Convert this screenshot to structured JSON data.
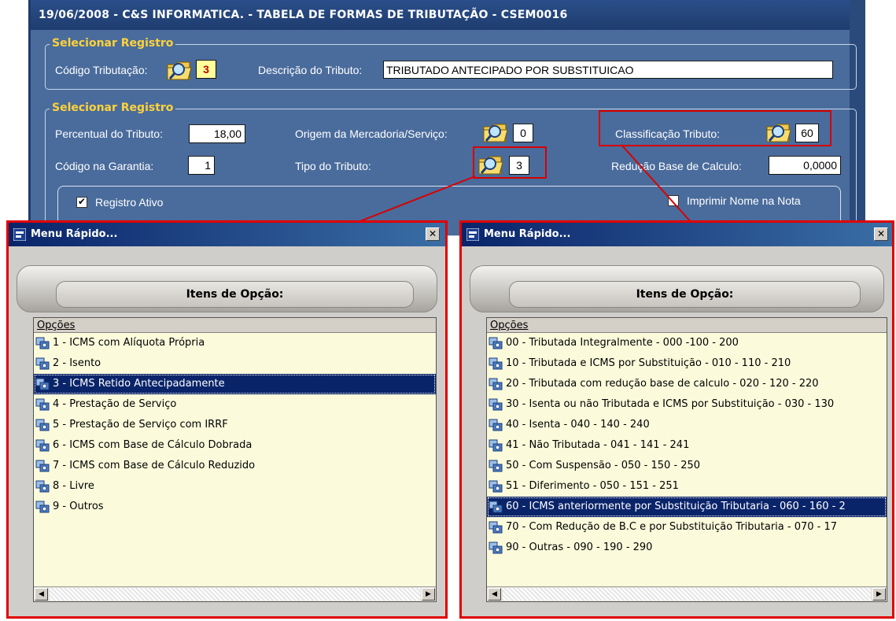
{
  "main": {
    "title": "19/06/2008  -  C&S INFORMATICA.  -  TABELA DE FORMAS DE TRIBUTAÇÃO  -  CSEM0016",
    "group1_title": "Selecionar Registro",
    "group2_title": "Selecionar Registro",
    "codigo_tributacao_label": "Código Tributação:",
    "codigo_tributacao_value": "3",
    "descricao_label": "Descrição do Tributo:",
    "descricao_value": "TRIBUTADO ANTECIPADO POR SUBSTITUICAO",
    "percentual_label": "Percentual do Tributo:",
    "percentual_value": "18,00",
    "origem_label": "Origem da Mercadoria/Serviço:",
    "origem_value": "0",
    "classificacao_label": "Classificação Tributo:",
    "classificacao_value": "60",
    "garantia_label": "Código na Garantia:",
    "garantia_value": "1",
    "tipo_label": "Tipo do Tributo:",
    "tipo_value": "3",
    "reducao_label": "Redução Base de Calculo:",
    "reducao_value": "0,0000",
    "registro_ativo_label": "Registro Ativo",
    "registro_ativo_checked": true,
    "imprimir_label": "Imprimir  Nome na Nota",
    "imprimir_checked": false
  },
  "dialog_left": {
    "title": "Menu Rápido...",
    "close": "✕",
    "header": "Itens de Opção:",
    "column": "Opções",
    "selected_index": 2,
    "items": [
      {
        "label": "1 - ICMS com Alíquota Própria"
      },
      {
        "label": "2 - Isento"
      },
      {
        "label": "3 - ICMS Retido Antecipadamente"
      },
      {
        "label": "4 - Prestação de Serviço"
      },
      {
        "label": "5 - Prestação de Serviço com IRRF"
      },
      {
        "label": "6 - ICMS com Base de Cálculo Dobrada"
      },
      {
        "label": "7 - ICMS com Base de Cálculo Reduzido"
      },
      {
        "label": "8 - Livre"
      },
      {
        "label": "9 - Outros"
      }
    ]
  },
  "dialog_right": {
    "title": "Menu Rápido...",
    "close": "✕",
    "header": "Itens de Opção:",
    "column": "Opções",
    "selected_index": 8,
    "items": [
      {
        "label": "00 - Tributada Integralmente - 000 -100 - 200"
      },
      {
        "label": "10 - Tributada e ICMS por Substituição - 010 - 110 - 210"
      },
      {
        "label": "20 - Tributada com redução base de calculo - 020 - 120 - 220"
      },
      {
        "label": "30 - Isenta ou não Tributada e ICMS por Substituição - 030 - 130"
      },
      {
        "label": "40 - Isenta  - 040 - 140 - 240"
      },
      {
        "label": "41 - Não Tributada - 041 - 141 - 241"
      },
      {
        "label": "50 - Com Suspensão - 050 - 150 - 250"
      },
      {
        "label": "51 - Diferimento - 050 - 151 - 251"
      },
      {
        "label": "60 - ICMS anteriormente por Substituição Tributaria - 060 - 160 - 2"
      },
      {
        "label": "70 - Com Redução de B.C e por Substituição Tributaria - 070 - 17"
      },
      {
        "label": "90 - Outras - 090 - 190 - 290"
      }
    ]
  },
  "colors": {
    "form_background": "#4a6c9c",
    "group_title": "#ffd23a",
    "highlight_border": "#e00000",
    "selection": "#0a246a",
    "list_background": "#fbfbdc"
  },
  "icons": {
    "lookup": "folder-magnifier-icon",
    "row": "gear-item-icon",
    "scroll_left": "arrow-left-icon",
    "scroll_right": "arrow-right-icon"
  }
}
